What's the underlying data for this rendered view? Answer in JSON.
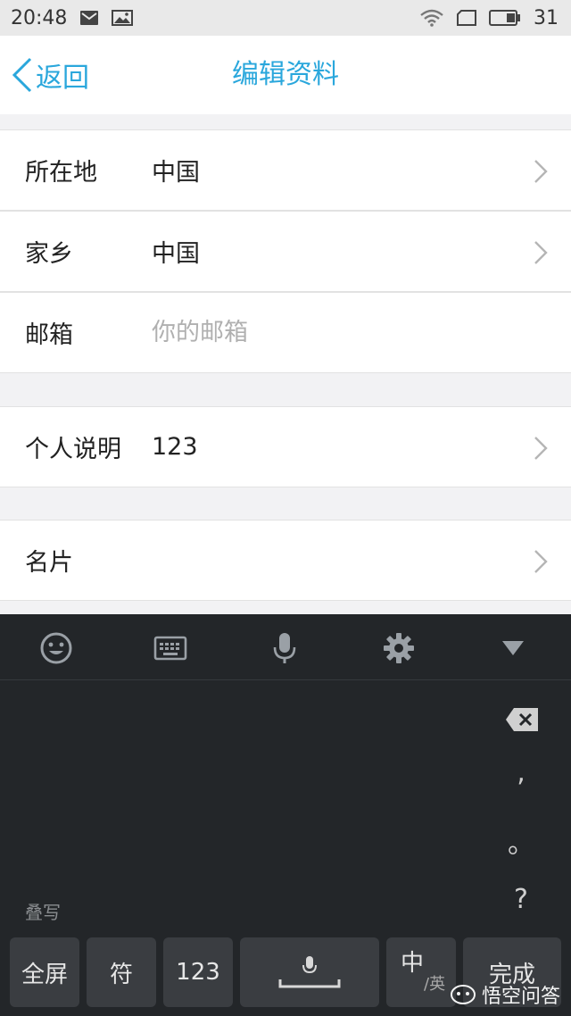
{
  "status_bar": {
    "time": "20:48",
    "battery": "31"
  },
  "nav": {
    "back_label": "返回",
    "title": "编辑资料"
  },
  "rows": [
    {
      "label": "所在地",
      "value": "中国"
    },
    {
      "label": "家乡",
      "value": "中国"
    },
    {
      "label": "邮箱",
      "placeholder": "你的邮箱"
    },
    {
      "label": "个人说明",
      "value": "123"
    },
    {
      "label": "名片"
    }
  ],
  "keyboard": {
    "handwrite_label": "叠写",
    "side_keys": [
      ",",
      "。",
      "?"
    ],
    "keys": {
      "fullscreen": "全屏",
      "symbols": "符",
      "numbers": "123",
      "lang_main": "中",
      "lang_sub": "英",
      "done": "完成"
    }
  },
  "watermark": "悟空问答",
  "colors": {
    "accent": "#2aa7dc",
    "keyboard_bg": "#232629",
    "key_bg": "#3a3d41"
  }
}
